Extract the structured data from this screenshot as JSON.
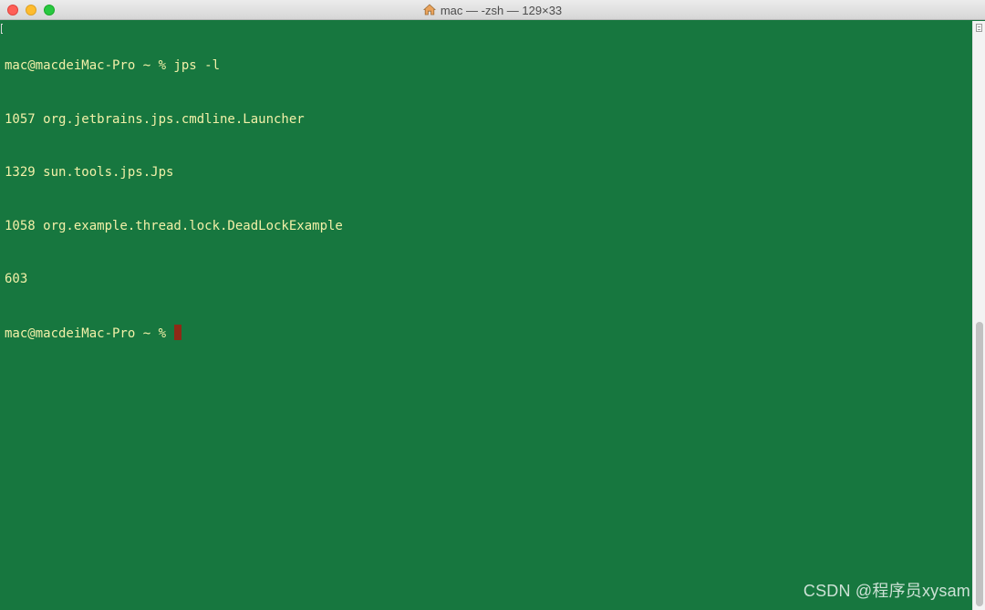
{
  "window": {
    "title": "mac — -zsh — 129×33",
    "title_icon": "home-icon",
    "background_color": "#17773f",
    "text_color": "#f2f0a8",
    "cursor_color": "#8e2a16"
  },
  "terminal": {
    "lines": [
      "mac@macdeiMac-Pro ~ % jps -l",
      "1057 org.jetbrains.jps.cmdline.Launcher",
      "1329 sun.tools.jps.Jps",
      "1058 org.example.thread.lock.DeadLockExample",
      "603"
    ],
    "prompt": "mac@macdeiMac-Pro ~ % "
  },
  "watermark": {
    "text": "CSDN @程序员xysam"
  }
}
